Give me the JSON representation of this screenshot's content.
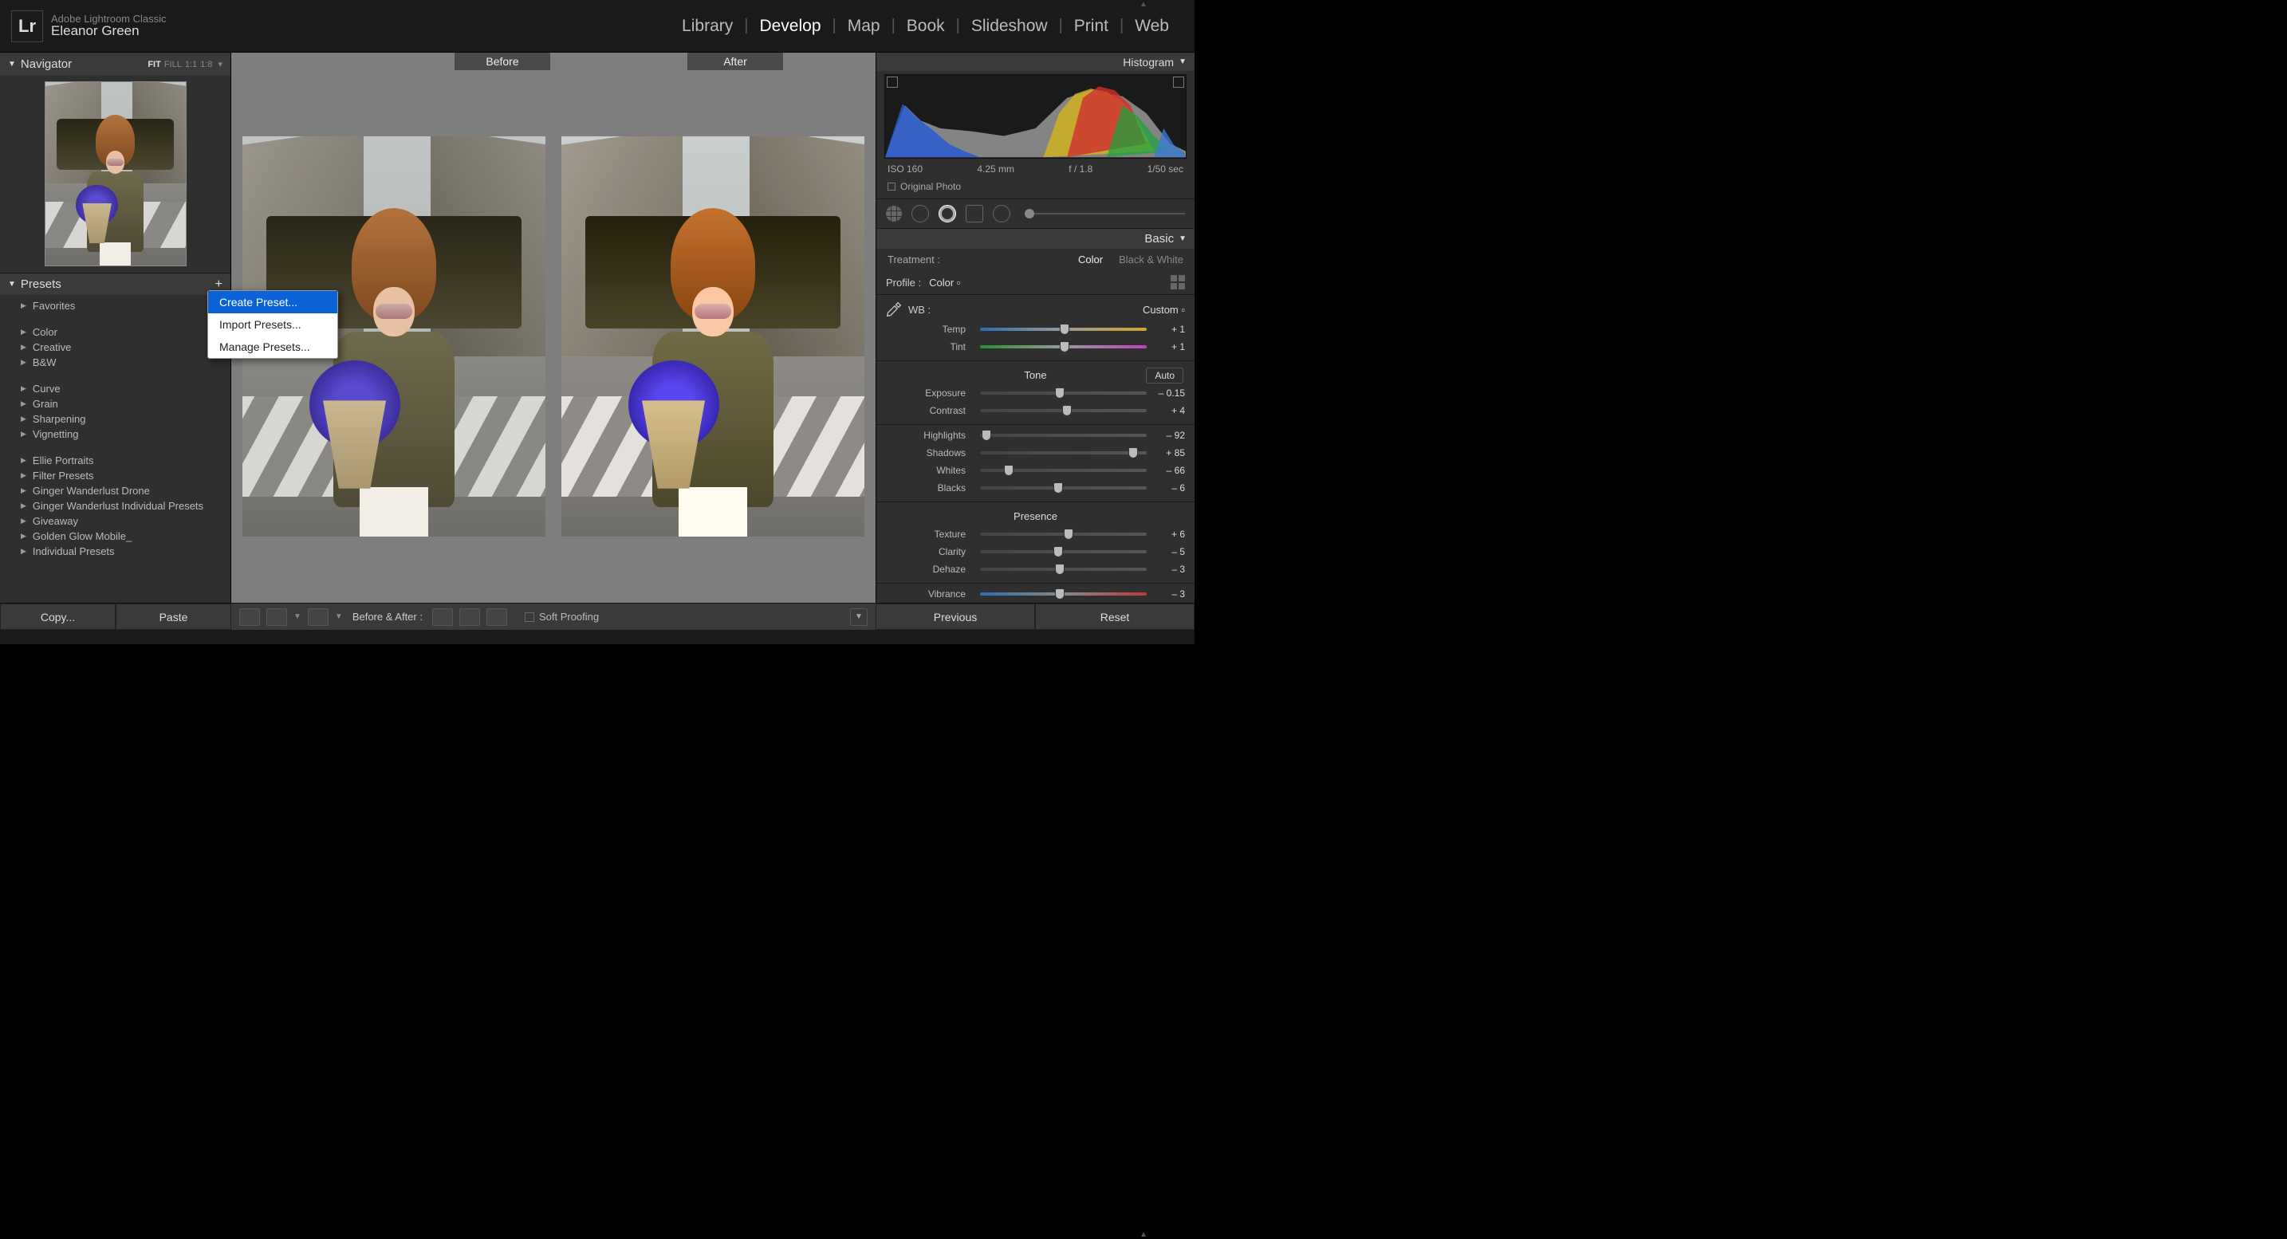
{
  "app": {
    "name": "Adobe Lightroom Classic",
    "user": "Eleanor Green",
    "logo": "Lr"
  },
  "modules": [
    "Library",
    "Develop",
    "Map",
    "Book",
    "Slideshow",
    "Print",
    "Web"
  ],
  "active_module": "Develop",
  "navigator": {
    "title": "Navigator",
    "zoom_options": [
      "FIT",
      "FILL",
      "1:1",
      "1:8"
    ],
    "zoom_selected": "FIT"
  },
  "presets": {
    "title": "Presets",
    "groups1": [
      "Favorites"
    ],
    "groups2": [
      "Color",
      "Creative",
      "B&W"
    ],
    "groups3": [
      "Curve",
      "Grain",
      "Sharpening",
      "Vignetting"
    ],
    "groups4": [
      "Ellie Portraits",
      "Filter Presets",
      "Ginger Wanderlust Drone",
      "Ginger Wanderlust Individual Presets",
      "Giveaway",
      "Golden Glow Mobile_",
      "Individual Presets"
    ]
  },
  "context_menu": [
    "Create Preset...",
    "Import Presets...",
    "Manage Presets..."
  ],
  "context_highlight": 0,
  "before_after": {
    "before": "Before",
    "after": "After",
    "toolbar_label": "Before & After :"
  },
  "histogram": {
    "title": "Histogram",
    "iso": "ISO 160",
    "focal": "4.25 mm",
    "aperture": "f / 1.8",
    "shutter": "1/50 sec",
    "original_label": "Original Photo"
  },
  "basic": {
    "title": "Basic",
    "treatment_label": "Treatment :",
    "color": "Color",
    "bw": "Black & White",
    "profile_label": "Profile :",
    "profile_value": "Color",
    "wb_label": "WB :",
    "wb_value": "Custom",
    "tone_label": "Tone",
    "auto": "Auto",
    "presence_label": "Presence",
    "sliders": {
      "temp": {
        "label": "Temp",
        "value": "+ 1",
        "pos": 50.5
      },
      "tint": {
        "label": "Tint",
        "value": "+ 1",
        "pos": 50.5
      },
      "exposure": {
        "label": "Exposure",
        "value": "– 0.15",
        "pos": 48
      },
      "contrast": {
        "label": "Contrast",
        "value": "+ 4",
        "pos": 52
      },
      "highlights": {
        "label": "Highlights",
        "value": "– 92",
        "pos": 4
      },
      "shadows": {
        "label": "Shadows",
        "value": "+ 85",
        "pos": 92
      },
      "whites": {
        "label": "Whites",
        "value": "– 66",
        "pos": 17
      },
      "blacks": {
        "label": "Blacks",
        "value": "– 6",
        "pos": 47
      },
      "texture": {
        "label": "Texture",
        "value": "+ 6",
        "pos": 53
      },
      "clarity": {
        "label": "Clarity",
        "value": "– 5",
        "pos": 47
      },
      "dehaze": {
        "label": "Dehaze",
        "value": "– 3",
        "pos": 48
      },
      "vibrance": {
        "label": "Vibrance",
        "value": "– 3",
        "pos": 48
      }
    }
  },
  "soft_proofing": "Soft Proofing",
  "buttons": {
    "copy": "Copy...",
    "paste": "Paste",
    "previous": "Previous",
    "reset": "Reset"
  }
}
